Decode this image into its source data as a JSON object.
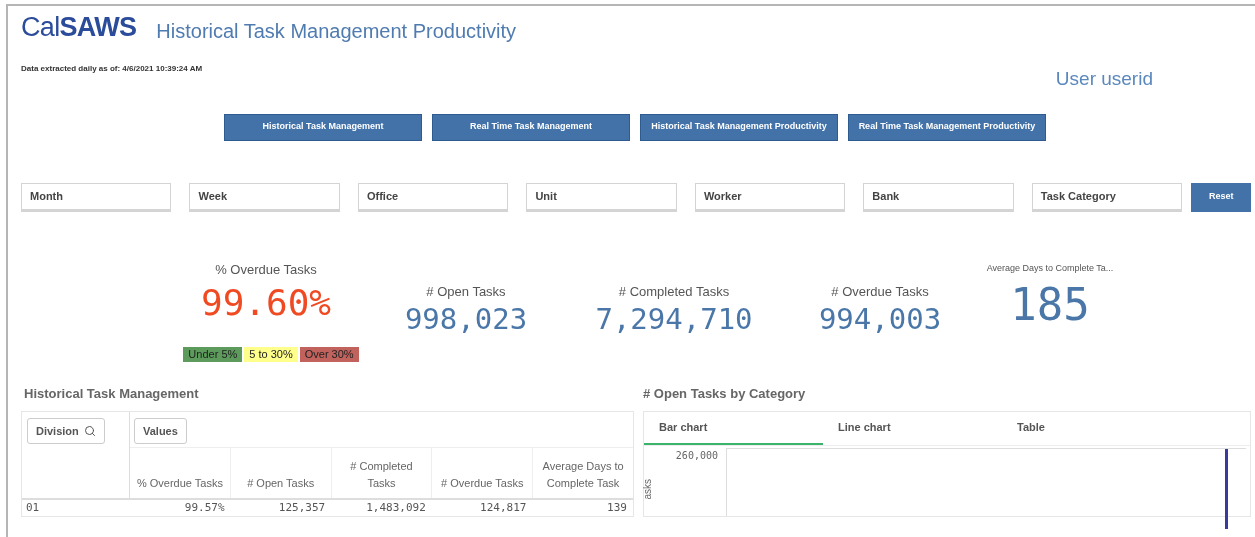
{
  "header": {
    "logo": "Cal**SAWS**",
    "title": "Historical Task Management Productivity",
    "extract_note": "Data extracted daily as of: 4/6/2021 10:39:24 AM",
    "user": "User userid"
  },
  "nav_buttons": [
    "Historical Task Management",
    "Real Time Task Management",
    "Historical Task Management Productivity",
    "Real Time Task Management Productivity"
  ],
  "filters": [
    "Month",
    "Week",
    "Office",
    "Unit",
    "Worker",
    "Bank",
    "Task Category"
  ],
  "reset_button": "Reset",
  "kpis": [
    {
      "title": "% Overdue Tasks",
      "value": "99.60%",
      "color": "#f04a23",
      "kind": "standard"
    },
    {
      "title": "# Open Tasks",
      "value": "998,023",
      "color": "#4a77a8",
      "kind": "standard"
    },
    {
      "title": "# Completed Tasks",
      "value": "7,294,710",
      "color": "#4a77a8",
      "kind": "standard"
    },
    {
      "title": "# Overdue Tasks",
      "value": "994,003",
      "color": "#4a77a8",
      "kind": "standard"
    },
    {
      "title": "Average Days to Complete Ta...",
      "value": "185",
      "color": "#4a77a8",
      "kind": "large"
    }
  ],
  "legend": [
    {
      "label": "Under 5%",
      "color": "#5c9b5c"
    },
    {
      "label": "5 to 30%",
      "color": "#ffff8c"
    },
    {
      "label": "Over 30%",
      "color": "#c2625c"
    }
  ],
  "table_panel": {
    "title": "Historical Task Management",
    "dimension_button": "Division",
    "values_button": "Values",
    "columns": [
      "% Overdue Tasks",
      "# Open Tasks",
      "# Completed Tasks",
      "# Overdue Tasks",
      "Average Days to Complete Task"
    ],
    "rows": [
      {
        "division": "01",
        "cells": [
          "99.57%",
          "125,357",
          "1,483,092",
          "124,817",
          "139"
        ]
      }
    ]
  },
  "chart_panel": {
    "title": "# Open Tasks by Category",
    "tabs": [
      {
        "label": "Bar chart",
        "selected": true
      },
      {
        "label": "Line chart",
        "selected": false
      },
      {
        "label": "Table",
        "selected": false
      }
    ],
    "y_tick": "260,000",
    "y_axis_label": "asks"
  }
}
